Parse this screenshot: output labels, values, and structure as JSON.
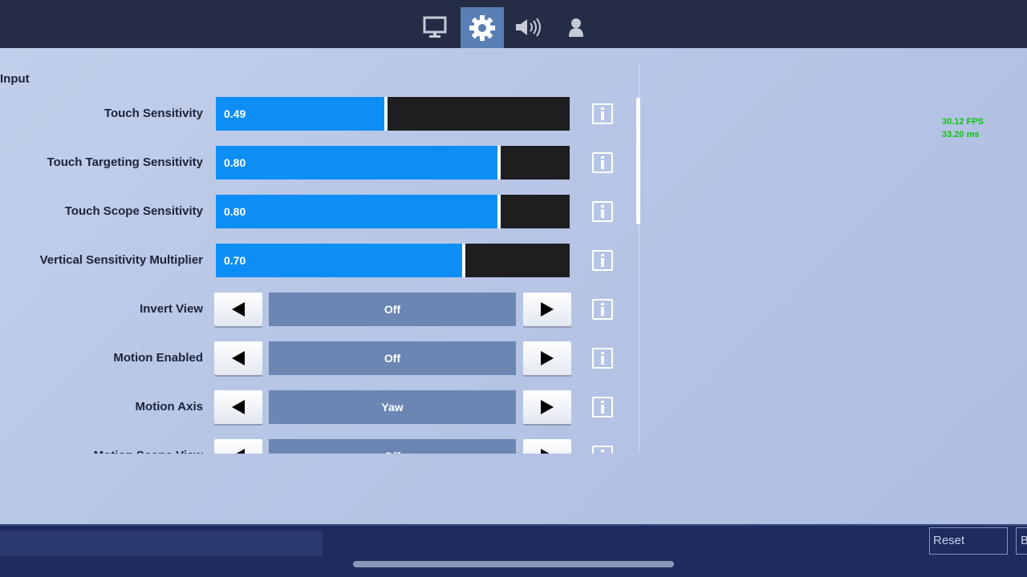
{
  "tabs": [
    {
      "icon": "monitor-icon",
      "active": false
    },
    {
      "icon": "gear-icon",
      "active": true
    },
    {
      "icon": "speaker-icon",
      "active": false
    },
    {
      "icon": "user-icon",
      "active": false
    }
  ],
  "section": {
    "title": "Input"
  },
  "sliders": [
    {
      "label": "Touch Sensitivity",
      "value": "0.49",
      "fill_fraction": 0.48
    },
    {
      "label": "Touch Targeting Sensitivity",
      "value": "0.80",
      "fill_fraction": 0.8
    },
    {
      "label": "Touch Scope Sensitivity",
      "value": "0.80",
      "fill_fraction": 0.8
    },
    {
      "label": "Vertical Sensitivity Multiplier",
      "value": "0.70",
      "fill_fraction": 0.7
    }
  ],
  "options": [
    {
      "label": "Invert View",
      "value": "Off"
    },
    {
      "label": "Motion Enabled",
      "value": "Off"
    },
    {
      "label": "Motion Axis",
      "value": "Yaw"
    },
    {
      "label": "Motion Scope View",
      "value": "Off"
    }
  ],
  "stats": {
    "fps": "30.12 FPS",
    "ms": "33.20 ms"
  },
  "bottom": {
    "reset_label": "Reset",
    "b_label": "B"
  },
  "colors": {
    "accent": "#0d8ef5",
    "slider_bg": "#1e1e20",
    "option_bg": "#6b86b2",
    "topbar": "#252c45",
    "fps": "#0ec40e"
  }
}
